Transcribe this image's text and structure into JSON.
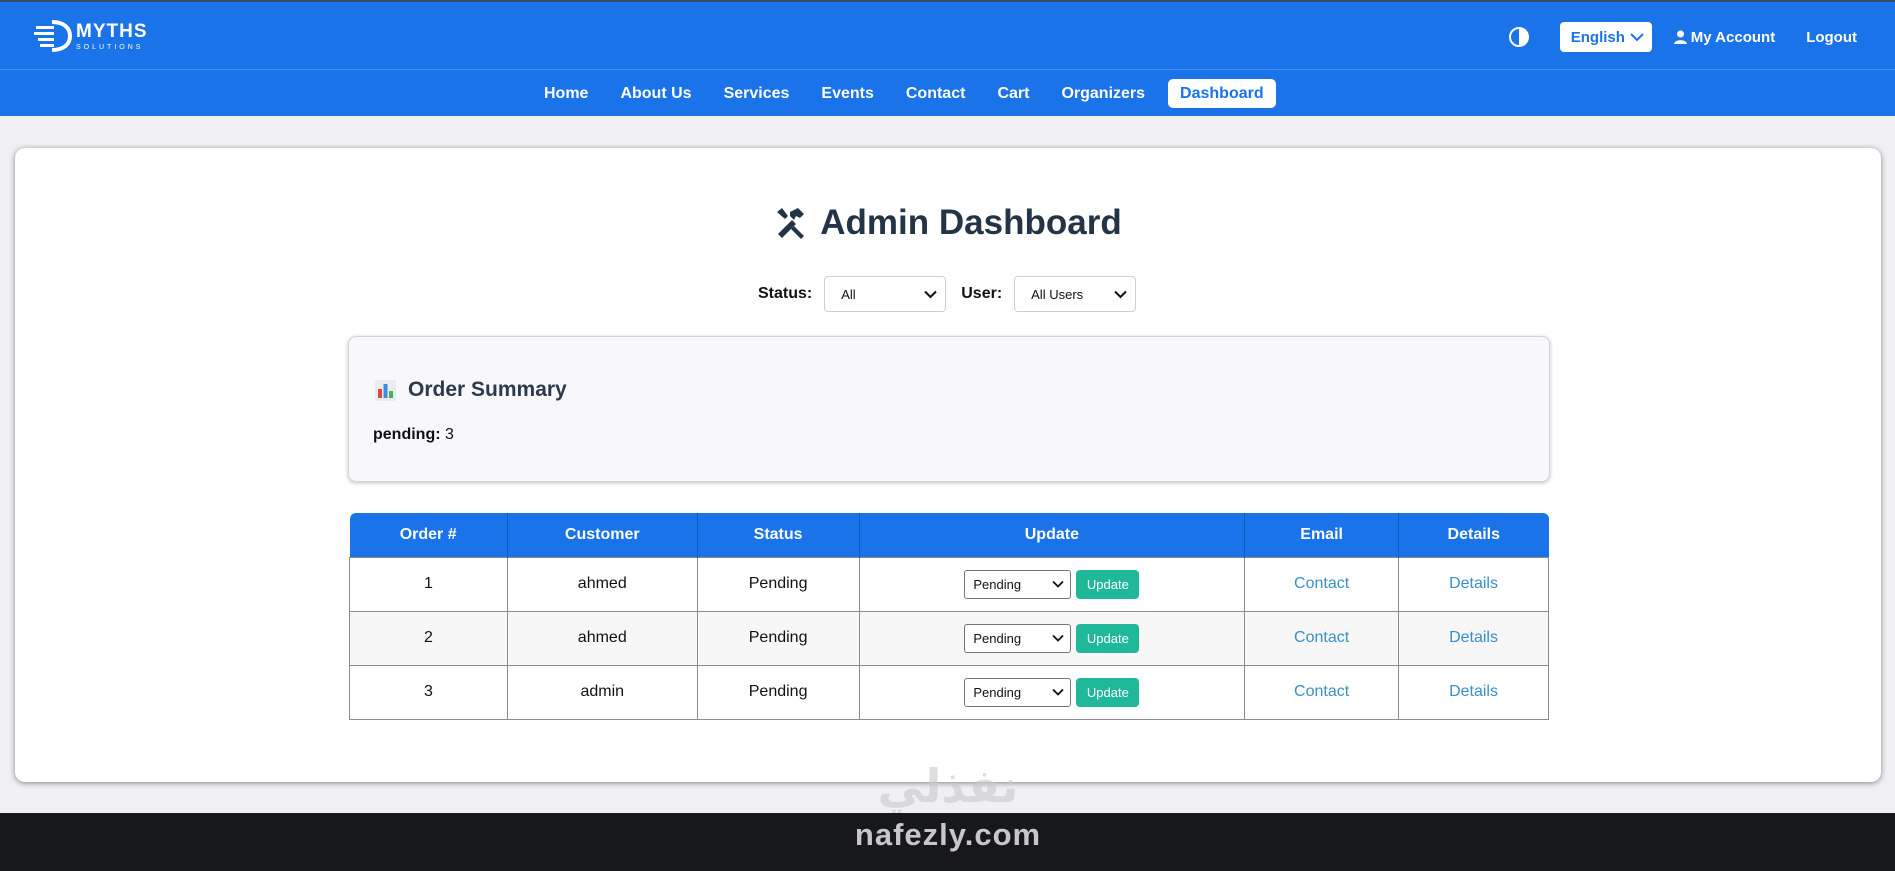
{
  "brand": {
    "word": "MYTHS",
    "sub": "SOLUTIONS"
  },
  "header": {
    "language": "English",
    "account": "My Account",
    "logout": "Logout"
  },
  "nav": {
    "items": [
      "Home",
      "About Us",
      "Services",
      "Events",
      "Contact",
      "Cart",
      "Organizers",
      "Dashboard"
    ],
    "active": "Dashboard"
  },
  "dashboard": {
    "title": "Admin Dashboard",
    "filters": {
      "status_label": "Status:",
      "status_value": "All",
      "user_label": "User:",
      "user_value": "All Users"
    },
    "summary": {
      "title": "Order Summary",
      "key": "pending:",
      "value": "3"
    },
    "table": {
      "columns": [
        "Order #",
        "Customer",
        "Status",
        "Update",
        "Email",
        "Details"
      ],
      "rows": [
        {
          "order": "1",
          "customer": "ahmed",
          "status": "Pending",
          "select": "Pending",
          "button": "Update",
          "email": "Contact",
          "details": "Details"
        },
        {
          "order": "2",
          "customer": "ahmed",
          "status": "Pending",
          "select": "Pending",
          "button": "Update",
          "email": "Contact",
          "details": "Details"
        },
        {
          "order": "3",
          "customer": "admin",
          "status": "Pending",
          "select": "Pending",
          "button": "Update",
          "email": "Contact",
          "details": "Details"
        }
      ]
    }
  },
  "watermark": {
    "arabic": "نفذلي",
    "latin": "nafezly.com"
  },
  "colors": {
    "primary": "#1a73e8",
    "update_button": "#1fb99a",
    "link": "#3a8fc9",
    "footer": "#17181b"
  }
}
